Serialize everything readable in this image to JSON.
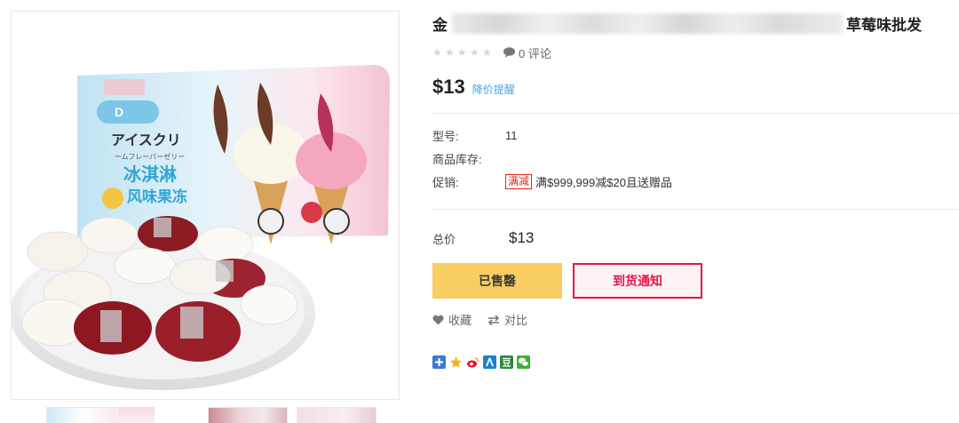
{
  "product": {
    "title_start": "金",
    "title_end": "草莓味批发",
    "comment_count_text": "0 评论",
    "price": "$13",
    "price_alert_label": "降价提醒"
  },
  "attributes": {
    "model_label": "型号:",
    "model_value": "11",
    "stock_label": "商品库存:",
    "stock_value": "",
    "promo_label": "促销:",
    "promo_tag": "满减",
    "promo_text": "满$999,999减$20且送赠品"
  },
  "total": {
    "label": "总价",
    "value": "$13"
  },
  "buttons": {
    "sold_out": "已售罄",
    "notify": "到货通知"
  },
  "actions": {
    "favorite": "收藏",
    "compare": "对比"
  },
  "rating": {
    "stars_filled": 0,
    "stars_total": 5
  },
  "share_icons": [
    "plus-share-icon",
    "qzone-star-icon",
    "weibo-icon",
    "renren-icon",
    "douban-icon",
    "wechat-icon"
  ],
  "image_text": {
    "jp_line1": "アイスクリ",
    "jp_line2": "ームフレーバーゼリー",
    "cn_line1": "冰淇淋",
    "cn_line2": "风味果冻"
  },
  "colors": {
    "accent_blue": "#4aa3df",
    "sold_out_bg": "#f8cd62",
    "notify_red": "#e2184a",
    "promo_red": "#e2231a"
  }
}
